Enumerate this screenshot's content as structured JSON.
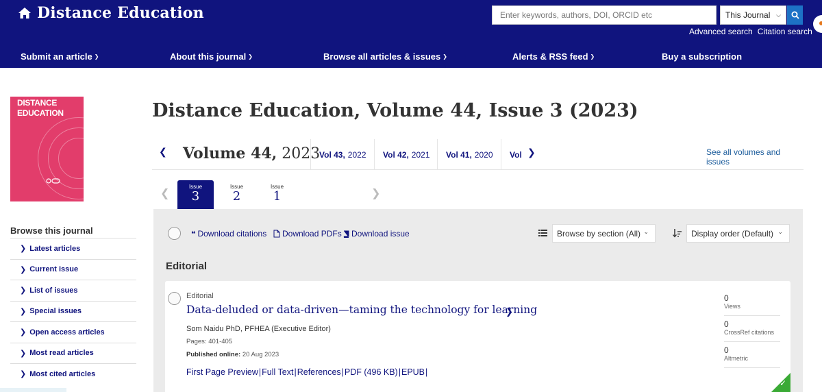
{
  "header": {
    "brand": "Distance Education",
    "search_placeholder": "Enter keywords, authors, DOI, ORCID etc",
    "search_scope": "This Journal",
    "advanced_search": "Advanced search",
    "citation_search": "Citation search"
  },
  "nav": [
    {
      "label": "Submit an article",
      "has_caret": true
    },
    {
      "label": "About this journal",
      "has_caret": true
    },
    {
      "label": "Browse all articles & issues",
      "has_caret": true
    },
    {
      "label": "Alerts & RSS feed",
      "has_caret": true
    },
    {
      "label": "Buy a subscription",
      "has_caret": false
    }
  ],
  "cover": {
    "title_line1": "DISTANCE",
    "title_line2": "EDUCATION",
    "colors": {
      "background": "#e23d6b"
    }
  },
  "sidebar": {
    "title": "Browse this journal",
    "items": [
      "Latest articles",
      "Current issue",
      "List of issues",
      "Special issues",
      "Open access articles",
      "Most read articles",
      "Most cited articles"
    ]
  },
  "page_title": "Distance Education, Volume 44, Issue 3 (2023)",
  "volumes": {
    "current_label": "Volume 44,",
    "current_year": "2023",
    "others": [
      {
        "vol": "Vol 43,",
        "year": "2022"
      },
      {
        "vol": "Vol 42,",
        "year": "2021"
      },
      {
        "vol": "Vol 41,",
        "year": "2020"
      },
      {
        "vol": "Vol",
        "year": ""
      }
    ],
    "see_all": "See all volumes and issues"
  },
  "issues": {
    "label": "Issue",
    "items": [
      {
        "num": "3",
        "active": true
      },
      {
        "num": "2",
        "active": false
      },
      {
        "num": "1",
        "active": false
      }
    ]
  },
  "toolbar": {
    "download_citations": "Download citations",
    "download_pdfs": "Download PDFs",
    "download_issue": "Download issue",
    "browse_by_section": "Browse by section (All)",
    "display_order": "Display order (Default)"
  },
  "section": "Editorial",
  "article": {
    "type": "Editorial",
    "title": "Data-deluded or data-driven—taming the technology for learning",
    "author": "Som Naidu PhD, PFHEA (Executive Editor)",
    "pages": "Pages: 401-405",
    "published_label": "Published online:",
    "published_date": "20 Aug 2023",
    "links": [
      "First Page Preview",
      "Full Text",
      "References",
      "PDF (496 KB)",
      "EPUB"
    ],
    "metrics": [
      {
        "value": "0",
        "label": "Views"
      },
      {
        "value": "0",
        "label": "CrossRef citations"
      },
      {
        "value": "0",
        "label": "Altmetric"
      }
    ]
  },
  "colors": {
    "header_bg": "#10147e",
    "link": "#10147e",
    "search_btn": "#1d72c6",
    "access_badge": "#3aaa35"
  }
}
